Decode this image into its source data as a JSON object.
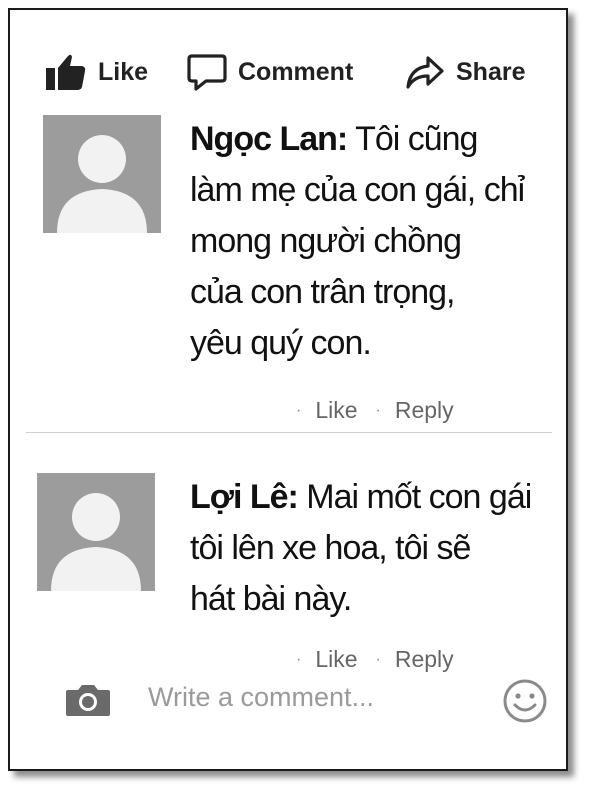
{
  "actions": {
    "like": "Like",
    "comment": "Comment",
    "share": "Share"
  },
  "comments": [
    {
      "author": "Ngọc Lan:",
      "lines": [
        "Tôi cũng",
        "làm mẹ của con gái, chỉ",
        "mong người chồng",
        "của con trân trọng,",
        "yêu quý con."
      ],
      "like": "Like",
      "reply": "Reply",
      "sep": "·"
    },
    {
      "author": "Lợi Lê:",
      "lines": [
        "Mai mốt con gái",
        "tôi lên xe hoa, tôi sẽ",
        "hát bài này."
      ],
      "like": "Like",
      "reply": "Reply",
      "sep": "·"
    }
  ],
  "composer": {
    "placeholder": "Write a comment..."
  },
  "colors": {
    "avatar_bg": "#9c9c9c",
    "icon": "#222222",
    "muted": "#777777"
  }
}
